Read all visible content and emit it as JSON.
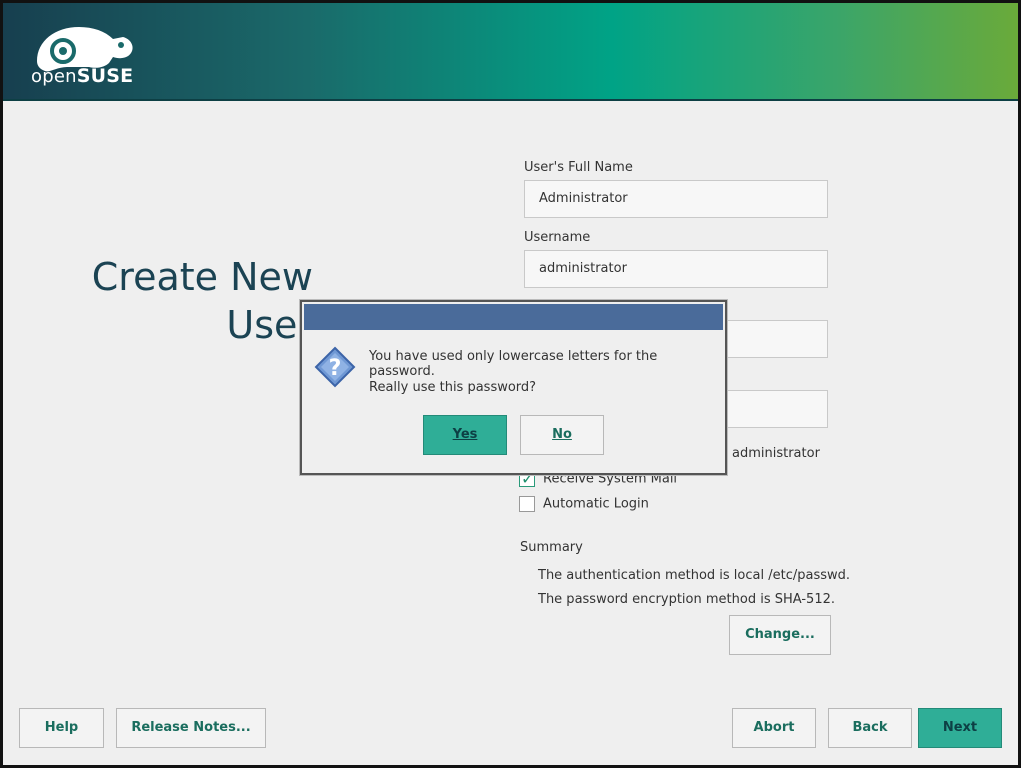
{
  "brand": {
    "logo_name": "openSUSE",
    "logo_light": "open",
    "logo_bold": "SUSE"
  },
  "page": {
    "title": "Create New User"
  },
  "form": {
    "full_name_label": "User's Full Name",
    "full_name_value": "Administrator",
    "username_label": "Username",
    "username_value": "administrator"
  },
  "options": {
    "admin_label": "administrator",
    "receive_mail_label": "Receive System Mail",
    "receive_mail_checked": true,
    "auto_login_label": "Automatic Login",
    "auto_login_checked": false
  },
  "summary": {
    "title": "Summary",
    "line1": "The authentication method is local /etc/passwd.",
    "line2": "The password encryption method is SHA-512.",
    "change_button": "Change..."
  },
  "dialog": {
    "message1": "You have used only lowercase letters for the password.",
    "message2": "Really use this password?",
    "yes_button": "Yes",
    "no_button": "No",
    "icon": "question-icon"
  },
  "footer": {
    "help_button": "Help",
    "release_notes_button": "Release Notes...",
    "abort_button": "Abort",
    "back_button": "Back",
    "next_button": "Next"
  },
  "colors": {
    "banner_start": "#173f4f",
    "banner_mid": "#00a386",
    "banner_end": "#6aaa3a",
    "accent": "#2fae97",
    "title_color": "#1b4353",
    "dialog_titlebar": "#4a6b9a"
  }
}
